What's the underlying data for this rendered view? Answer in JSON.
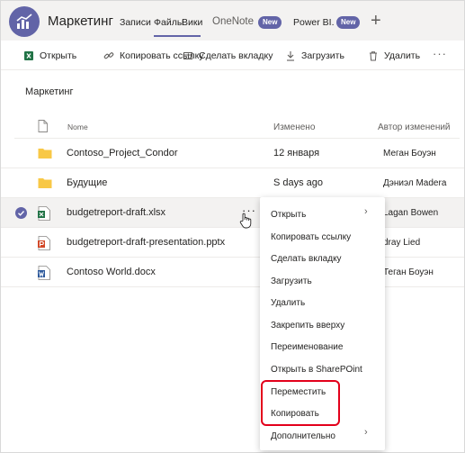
{
  "header": {
    "team_name": "Маркетинг",
    "tabs": [
      {
        "label": "Записи"
      },
      {
        "label": "Файлы"
      },
      {
        "label": "Вики"
      },
      {
        "label": "OneNote",
        "badge": "New"
      },
      {
        "label": "Power BI.",
        "badge": "New"
      }
    ],
    "add_tab": "+"
  },
  "toolbar": {
    "open": "Открыть",
    "copy_link": "Копировать ссылку",
    "make_tab": "Сделать вкладку",
    "upload": "Загрузить",
    "delete": "Удалить",
    "more": "···"
  },
  "breadcrumb": "Маркетинг",
  "table": {
    "headers": {
      "name": "Nome",
      "modified": "Изменено",
      "author": "Автор изменений"
    },
    "rows": [
      {
        "icon": "folder-icon",
        "name": "Contoso_Project_Condor",
        "modified": "12 января",
        "author": "Меган Боуэн"
      },
      {
        "icon": "folder-icon",
        "name": "Будущие",
        "modified": "S days ago",
        "author": "Дэниэл Madera"
      },
      {
        "icon": "excel-file-icon",
        "name": "budgetreport-draft.xlsx",
        "modified": "",
        "author": "Lagan Bowen",
        "selected": true,
        "more": "···"
      },
      {
        "icon": "powerpoint-file-icon",
        "name": "budgetreport-draft-presentation.pptx",
        "modified": "",
        "author": "dray Lied"
      },
      {
        "icon": "word-file-icon",
        "name": "Contoso World.docx",
        "modified": "",
        "author": "Теган Боуэн"
      }
    ]
  },
  "context_menu": {
    "items": [
      {
        "label": "Открыть",
        "submenu": true
      },
      {
        "label": "Копировать ссылку"
      },
      {
        "label": "Сделать вкладку"
      },
      {
        "label": "Загрузить"
      },
      {
        "label": "Удалить"
      },
      {
        "label": "Закрепить вверху"
      },
      {
        "label": "Переименование"
      },
      {
        "label": "Открыть в SharePOint"
      },
      {
        "label": "Переместить",
        "highlighted": true
      },
      {
        "label": "Копировать",
        "highlighted": true
      },
      {
        "label": "Дополнительно",
        "submenu": true
      }
    ],
    "chevron": "›"
  },
  "colors": {
    "accent": "#6264a7",
    "highlight": "#e3001b",
    "folder": "#f8c846",
    "excel": "#217346",
    "powerpoint": "#d24726",
    "word": "#2b579a"
  }
}
